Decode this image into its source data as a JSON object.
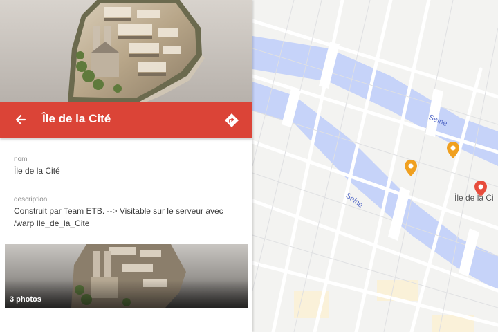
{
  "place": {
    "title": "Île de la Cité",
    "fields": [
      {
        "label": "nom",
        "value": "Île de la Cité"
      },
      {
        "label": "description",
        "value": "Construit par Team ETB. --> Visitable sur le serveur avec /warp Ile_de_la_Cite"
      }
    ],
    "photos_label": "3 photos"
  },
  "map": {
    "river_labels": [
      "Seine",
      "Seine"
    ],
    "place_label": "Île de la Ci",
    "colors": {
      "header": "#db4437",
      "river": "#c6d3f9",
      "pin_selected": "#e74c3c",
      "pin_other": "#f0a020"
    }
  },
  "icons": {
    "back": "arrow-left-icon",
    "directions": "directions-icon",
    "pins": [
      "map-pin-icon"
    ]
  }
}
